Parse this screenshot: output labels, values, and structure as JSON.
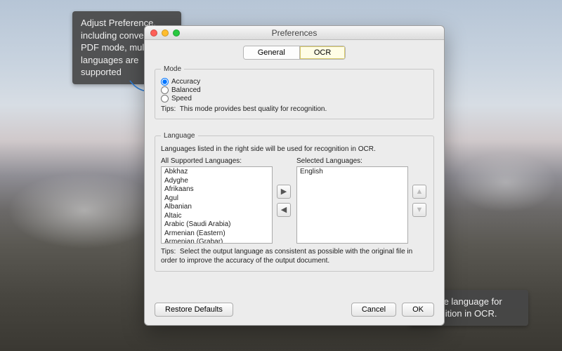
{
  "callouts": {
    "left": "Adjust Preference, including converting PDF mode, multiple languages are supported",
    "right": "Choose language for recognition in OCR."
  },
  "window": {
    "title": "Preferences"
  },
  "tabs": {
    "general": "General",
    "ocr": "OCR",
    "active": "ocr"
  },
  "mode": {
    "legend": "Mode",
    "options": [
      "Accuracy",
      "Balanced",
      "Speed"
    ],
    "selected": 0,
    "tips_label": "Tips:",
    "tips_text": "This mode provides best quality for recognition."
  },
  "language": {
    "legend": "Language",
    "desc": "Languages listed in the right side will be used for recognition in OCR.",
    "all_label": "All Supported Languages:",
    "selected_label": "Selected Languages:",
    "all": [
      "Abkhaz",
      "Adyghe",
      "Afrikaans",
      "Agul",
      "Albanian",
      "Altaic",
      "Arabic (Saudi Arabia)",
      "Armenian (Eastern)",
      "Armenian (Grabar)"
    ],
    "selected": [
      "English"
    ],
    "tips_label": "Tips:",
    "tips_text": "Select the output language as consistent as possible with the original file in order to improve the accuracy of the output document."
  },
  "buttons": {
    "restore": "Restore Defaults",
    "cancel": "Cancel",
    "ok": "OK"
  },
  "icons": {
    "add": "▶",
    "remove": "◀",
    "up": "▲",
    "down": "▼"
  }
}
